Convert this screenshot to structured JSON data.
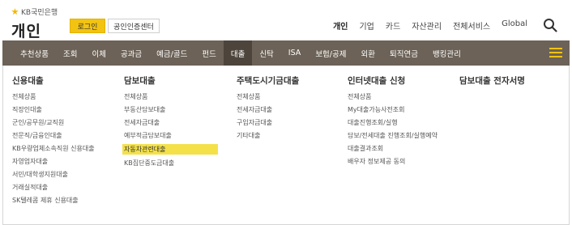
{
  "header": {
    "brand": "KB국민은행",
    "section_title": "개인",
    "login_label": "로그인",
    "cert_center_label": "공인인증센터",
    "util_links": [
      {
        "label": "개인",
        "active": true
      },
      {
        "label": "기업",
        "active": false
      },
      {
        "label": "카드",
        "active": false
      },
      {
        "label": "자산관리",
        "active": false
      },
      {
        "label": "전체서비스",
        "active": false
      },
      {
        "label": "Global",
        "active": false
      }
    ],
    "search_icon": "search-icon"
  },
  "gnb": {
    "items": [
      {
        "label": "추천상품",
        "active": false
      },
      {
        "label": "조회",
        "active": false
      },
      {
        "label": "이체",
        "active": false
      },
      {
        "label": "공과금",
        "active": false
      },
      {
        "label": "예금/골드",
        "active": false
      },
      {
        "label": "펀드",
        "active": false
      },
      {
        "label": "대출",
        "active": true
      },
      {
        "label": "신탁",
        "active": false
      },
      {
        "label": "ISA",
        "active": false
      },
      {
        "label": "보험/공제",
        "active": false
      },
      {
        "label": "외환",
        "active": false
      },
      {
        "label": "퇴직연금",
        "active": false
      },
      {
        "label": "뱅킹관리",
        "active": false
      }
    ],
    "menu_icon": "hamburger-icon",
    "accent_color": "#f2c311",
    "bar_color": "#6c6257"
  },
  "mega_menu": {
    "columns": [
      {
        "title": "신용대출",
        "items": [
          "전체상품",
          "직장인대출",
          "군인/공무원/교직원",
          "전문직/금융인대출",
          "KB우량업체소속직원 신용대출",
          "자영업자대출",
          "서민/대학생지원대출",
          "거래실적대출",
          "SK텔레콤 제휴 신용대출"
        ]
      },
      {
        "title": "담보대출",
        "items": [
          "전체상품",
          "부동산담보대출",
          "전세자금대출",
          "예부적금담보대출",
          "자동차관련대출",
          "KB집단중도금대출"
        ]
      },
      {
        "title": "주택도시기금대출",
        "items": [
          "전체상품",
          "전세자금대출",
          "구입자금대출",
          "기타대출"
        ]
      },
      {
        "title": "인터넷대출 신청",
        "items": [
          "전체상품",
          "My대출가능사전조회",
          "대출진행조회/실행",
          "담보/전세대출 진행조회/실행예약",
          "대출결과조회",
          "배우자 정보제공 동의"
        ]
      },
      {
        "title": "담보대출 전자서명",
        "items": []
      }
    ],
    "highlighted_item": "자동차관련대출",
    "highlight_color": "#f4e14a"
  }
}
